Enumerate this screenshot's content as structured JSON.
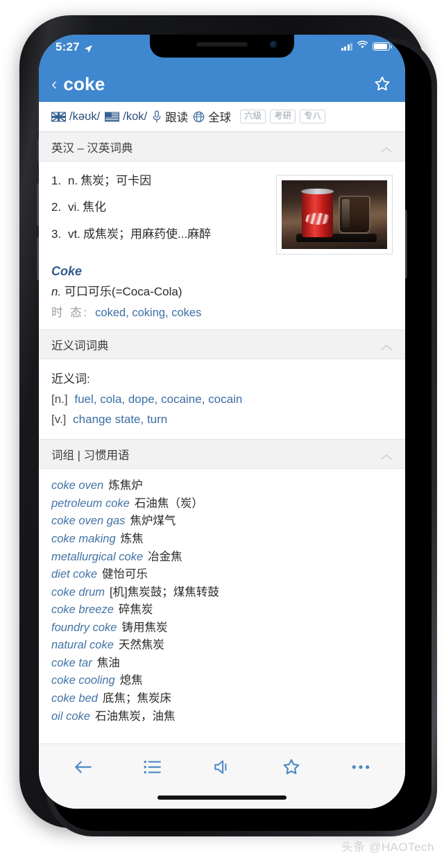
{
  "status_bar": {
    "time": "5:27",
    "location_icon": "location-arrow-icon",
    "signal_icon": "cellular-signal-icon",
    "wifi_icon": "wifi-icon",
    "battery_icon": "battery-icon"
  },
  "nav": {
    "back_icon": "chevron-left-icon",
    "title": "coke",
    "star_icon": "star-outline-icon"
  },
  "phonetics": {
    "uk": {
      "flag_icon": "uk-flag-icon",
      "text": "/kəʊk/"
    },
    "us": {
      "flag_icon": "us-flag-icon",
      "text": "/kok/"
    },
    "follow_read": {
      "icon": "microphone-icon",
      "label": "跟读"
    },
    "global": {
      "icon": "globe-icon",
      "label": "全球"
    },
    "badges": [
      "六级",
      "考研",
      "专八"
    ]
  },
  "sections": {
    "dictionary": {
      "title": "英汉 – 汉英词典",
      "collapse_icon": "chevron-up-icon",
      "definitions": [
        {
          "num": "1.",
          "pos": "n.",
          "text": "焦炭；可卡因"
        },
        {
          "num": "2.",
          "pos": "vi.",
          "text": "焦化"
        },
        {
          "num": "3.",
          "pos": "vt.",
          "text": "成焦炭；用麻药使...麻醉"
        }
      ],
      "thumbnail_alt": "coca-cola-can-and-glass-photo",
      "proper_noun": {
        "word": "Coke",
        "pos": "n.",
        "meaning": "可口可乐(=Coca-Cola)",
        "tense_label": "时 态:",
        "tense_value": "coked, coking, cokes"
      }
    },
    "synonyms": {
      "title": "近义词词典",
      "collapse_icon": "chevron-up-icon",
      "heading": "近义词:",
      "groups": [
        {
          "pos": "[n.]",
          "words": "fuel, cola, dope, cocaine, cocain"
        },
        {
          "pos": "[v.]",
          "words": "change state, turn"
        }
      ]
    },
    "phrases": {
      "title": "词组 | 习惯用语",
      "collapse_icon": "chevron-up-icon",
      "items": [
        {
          "en": "coke oven",
          "cn": "炼焦炉"
        },
        {
          "en": "petroleum coke",
          "cn": "石油焦（炭）"
        },
        {
          "en": "coke oven gas",
          "cn": "焦炉煤气"
        },
        {
          "en": "coke making",
          "cn": "炼焦"
        },
        {
          "en": "metallurgical coke",
          "cn": "冶金焦"
        },
        {
          "en": "diet coke",
          "cn": "健怡可乐"
        },
        {
          "en": "coke drum",
          "cn": "[机]焦炭鼓；煤焦转鼓"
        },
        {
          "en": "coke breeze",
          "cn": "碎焦炭"
        },
        {
          "en": "foundry coke",
          "cn": "铸用焦炭"
        },
        {
          "en": "natural coke",
          "cn": "天然焦炭"
        },
        {
          "en": "coke tar",
          "cn": "焦油"
        },
        {
          "en": "coke cooling",
          "cn": "熄焦"
        },
        {
          "en": "coke bed",
          "cn": "底焦；焦炭床"
        },
        {
          "en": "oil coke",
          "cn": "石油焦炭，油焦"
        }
      ]
    }
  },
  "toolbar": {
    "back_icon": "arrow-left-icon",
    "list_icon": "list-icon",
    "speaker_icon": "speaker-icon",
    "favorite_icon": "star-outline-icon",
    "more_icon": "ellipsis-icon"
  },
  "watermark": "头条 @HAOTech",
  "colors": {
    "accent_blue": "#3f87cf",
    "link_blue": "#3b6ea5",
    "section_bg": "#f2f2f2",
    "toolbar_bg": "#f7f7f7"
  }
}
